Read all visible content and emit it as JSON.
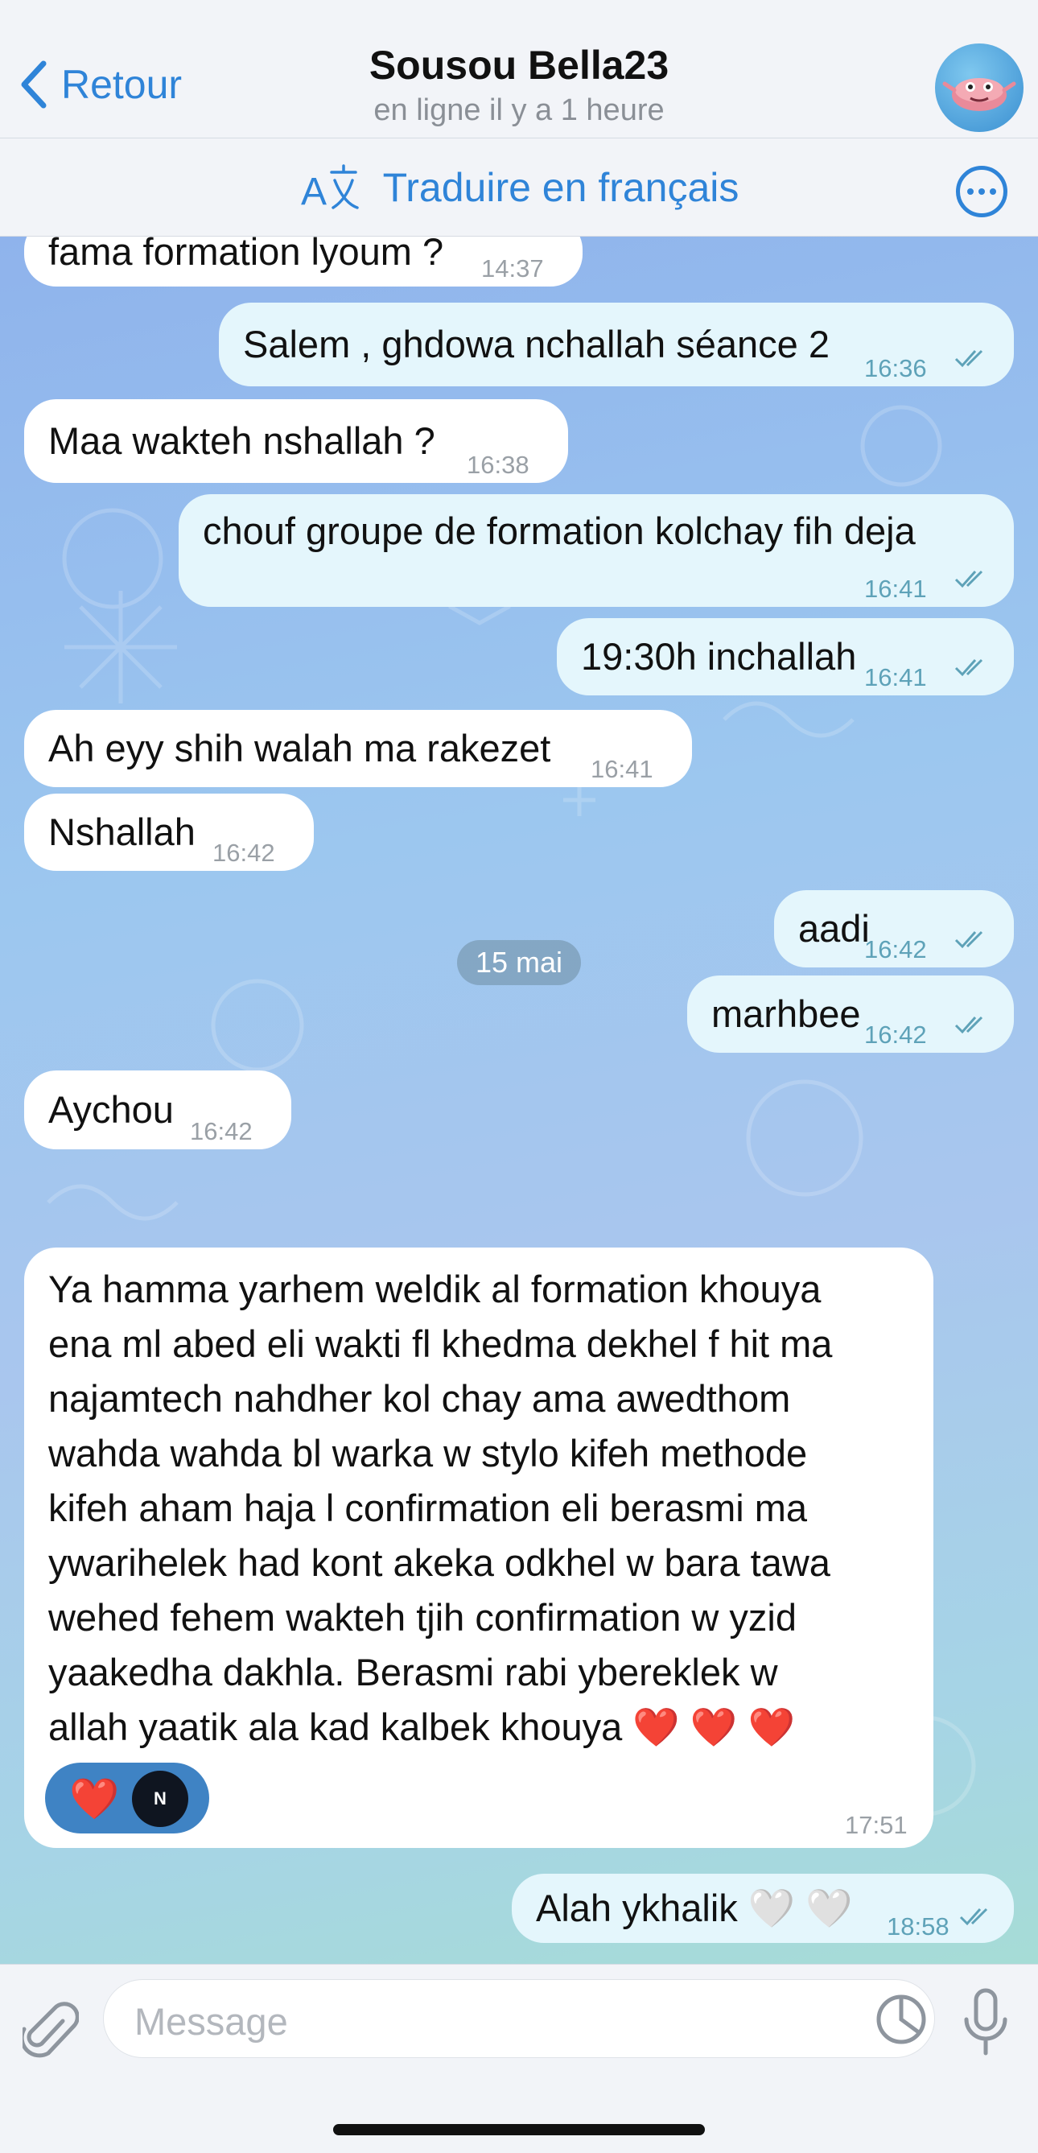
{
  "header": {
    "back_label": "Retour",
    "contact_name": "Sousou Bella23",
    "status": "en ligne il y a 1 heure"
  },
  "translate_bar": {
    "label": "Traduire en français"
  },
  "messages": [
    {
      "dir": "in",
      "text": "fama formation lyoum ?",
      "time": "14:37"
    },
    {
      "dir": "out",
      "text": "Salem , ghdowa nchallah séance 2",
      "time": "16:36"
    },
    {
      "dir": "in",
      "text": "Maa wakteh nshallah ?",
      "time": "16:38"
    },
    {
      "dir": "out",
      "text": "chouf groupe de formation kolchay fih deja",
      "time": "16:41"
    },
    {
      "dir": "out",
      "text": "19:30h inchallah",
      "time": "16:41"
    },
    {
      "dir": "in",
      "text": "Ah eyy shih walah ma rakezet",
      "time": "16:41"
    },
    {
      "dir": "in",
      "text": "Nshallah",
      "time": "16:42"
    },
    {
      "dir": "out",
      "text": "aadi",
      "time": "16:42"
    },
    {
      "dir": "out",
      "text": "marhbee",
      "time": "16:42"
    },
    {
      "dir": "in",
      "text": "Aychou",
      "time": "16:42"
    }
  ],
  "date_separator": "15 mai",
  "long_message": {
    "lines": [
      "Ya hamma yarhem weldik al formation khouya",
      "ena ml abed eli wakti fl khedma dekhel f hit ma",
      "najamtech nahdher kol chay ama awedthom",
      "wahda wahda bl warka w stylo kifeh methode",
      "kifeh aham haja l confirmation eli berasmi ma",
      "ywarihelek had kont akeka odkhel w bara tawa",
      "wehed fehem wakteh tjih confirmation w yzid",
      "yaakedha dakhla. Berasmi rabi ybereklek w",
      "allah yaatik ala kad kalbek khouya ❤️ ❤️ ❤️"
    ],
    "time": "17:51",
    "reaction": "❤️"
  },
  "last_message": {
    "text": "Alah ykhalik 🤍 🤍",
    "time": "18:58"
  },
  "composer": {
    "placeholder": "Message"
  }
}
